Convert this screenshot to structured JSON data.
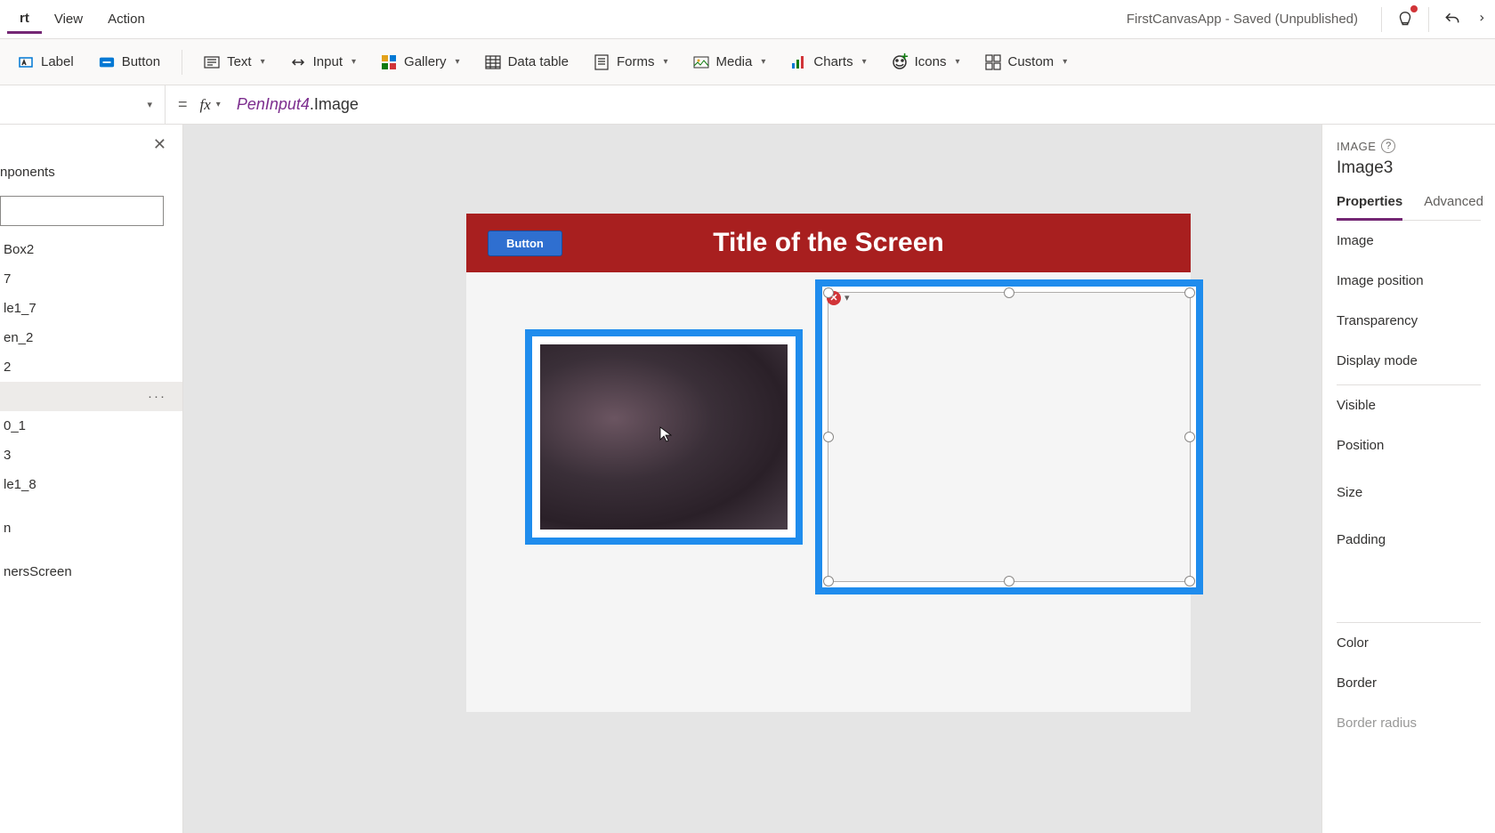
{
  "menubar": {
    "items": [
      "rt",
      "View",
      "Action"
    ],
    "appTitle": "FirstCanvasApp - Saved (Unpublished)"
  },
  "ribbon": {
    "label": "Label",
    "button": "Button",
    "text": "Text",
    "input": "Input",
    "gallery": "Gallery",
    "datatable": "Data table",
    "forms": "Forms",
    "media": "Media",
    "charts": "Charts",
    "icons": "Icons",
    "custom": "Custom"
  },
  "formula": {
    "eq": "=",
    "fx": "fx",
    "obj": "PenInput4",
    "prop": ".Image"
  },
  "leftPanel": {
    "tab": "nponents",
    "items": [
      "Box2",
      "7",
      "le1_7",
      "en_2",
      "2",
      "",
      "0_1",
      "3",
      "le1_8",
      "",
      "n",
      "",
      "nersScreen"
    ],
    "selectedIndex": 5
  },
  "canvas": {
    "headerTitle": "Title of the Screen",
    "buttonLabel": "Button"
  },
  "rightPanel": {
    "type": "IMAGE",
    "name": "Image3",
    "tabs": {
      "properties": "Properties",
      "advanced": "Advanced"
    },
    "rows": {
      "image": "Image",
      "imagePosition": "Image position",
      "transparency": "Transparency",
      "displayMode": "Display mode",
      "visible": "Visible",
      "position": "Position",
      "size": "Size",
      "padding": "Padding",
      "color": "Color",
      "border": "Border",
      "borderRadius": "Border radius"
    }
  }
}
